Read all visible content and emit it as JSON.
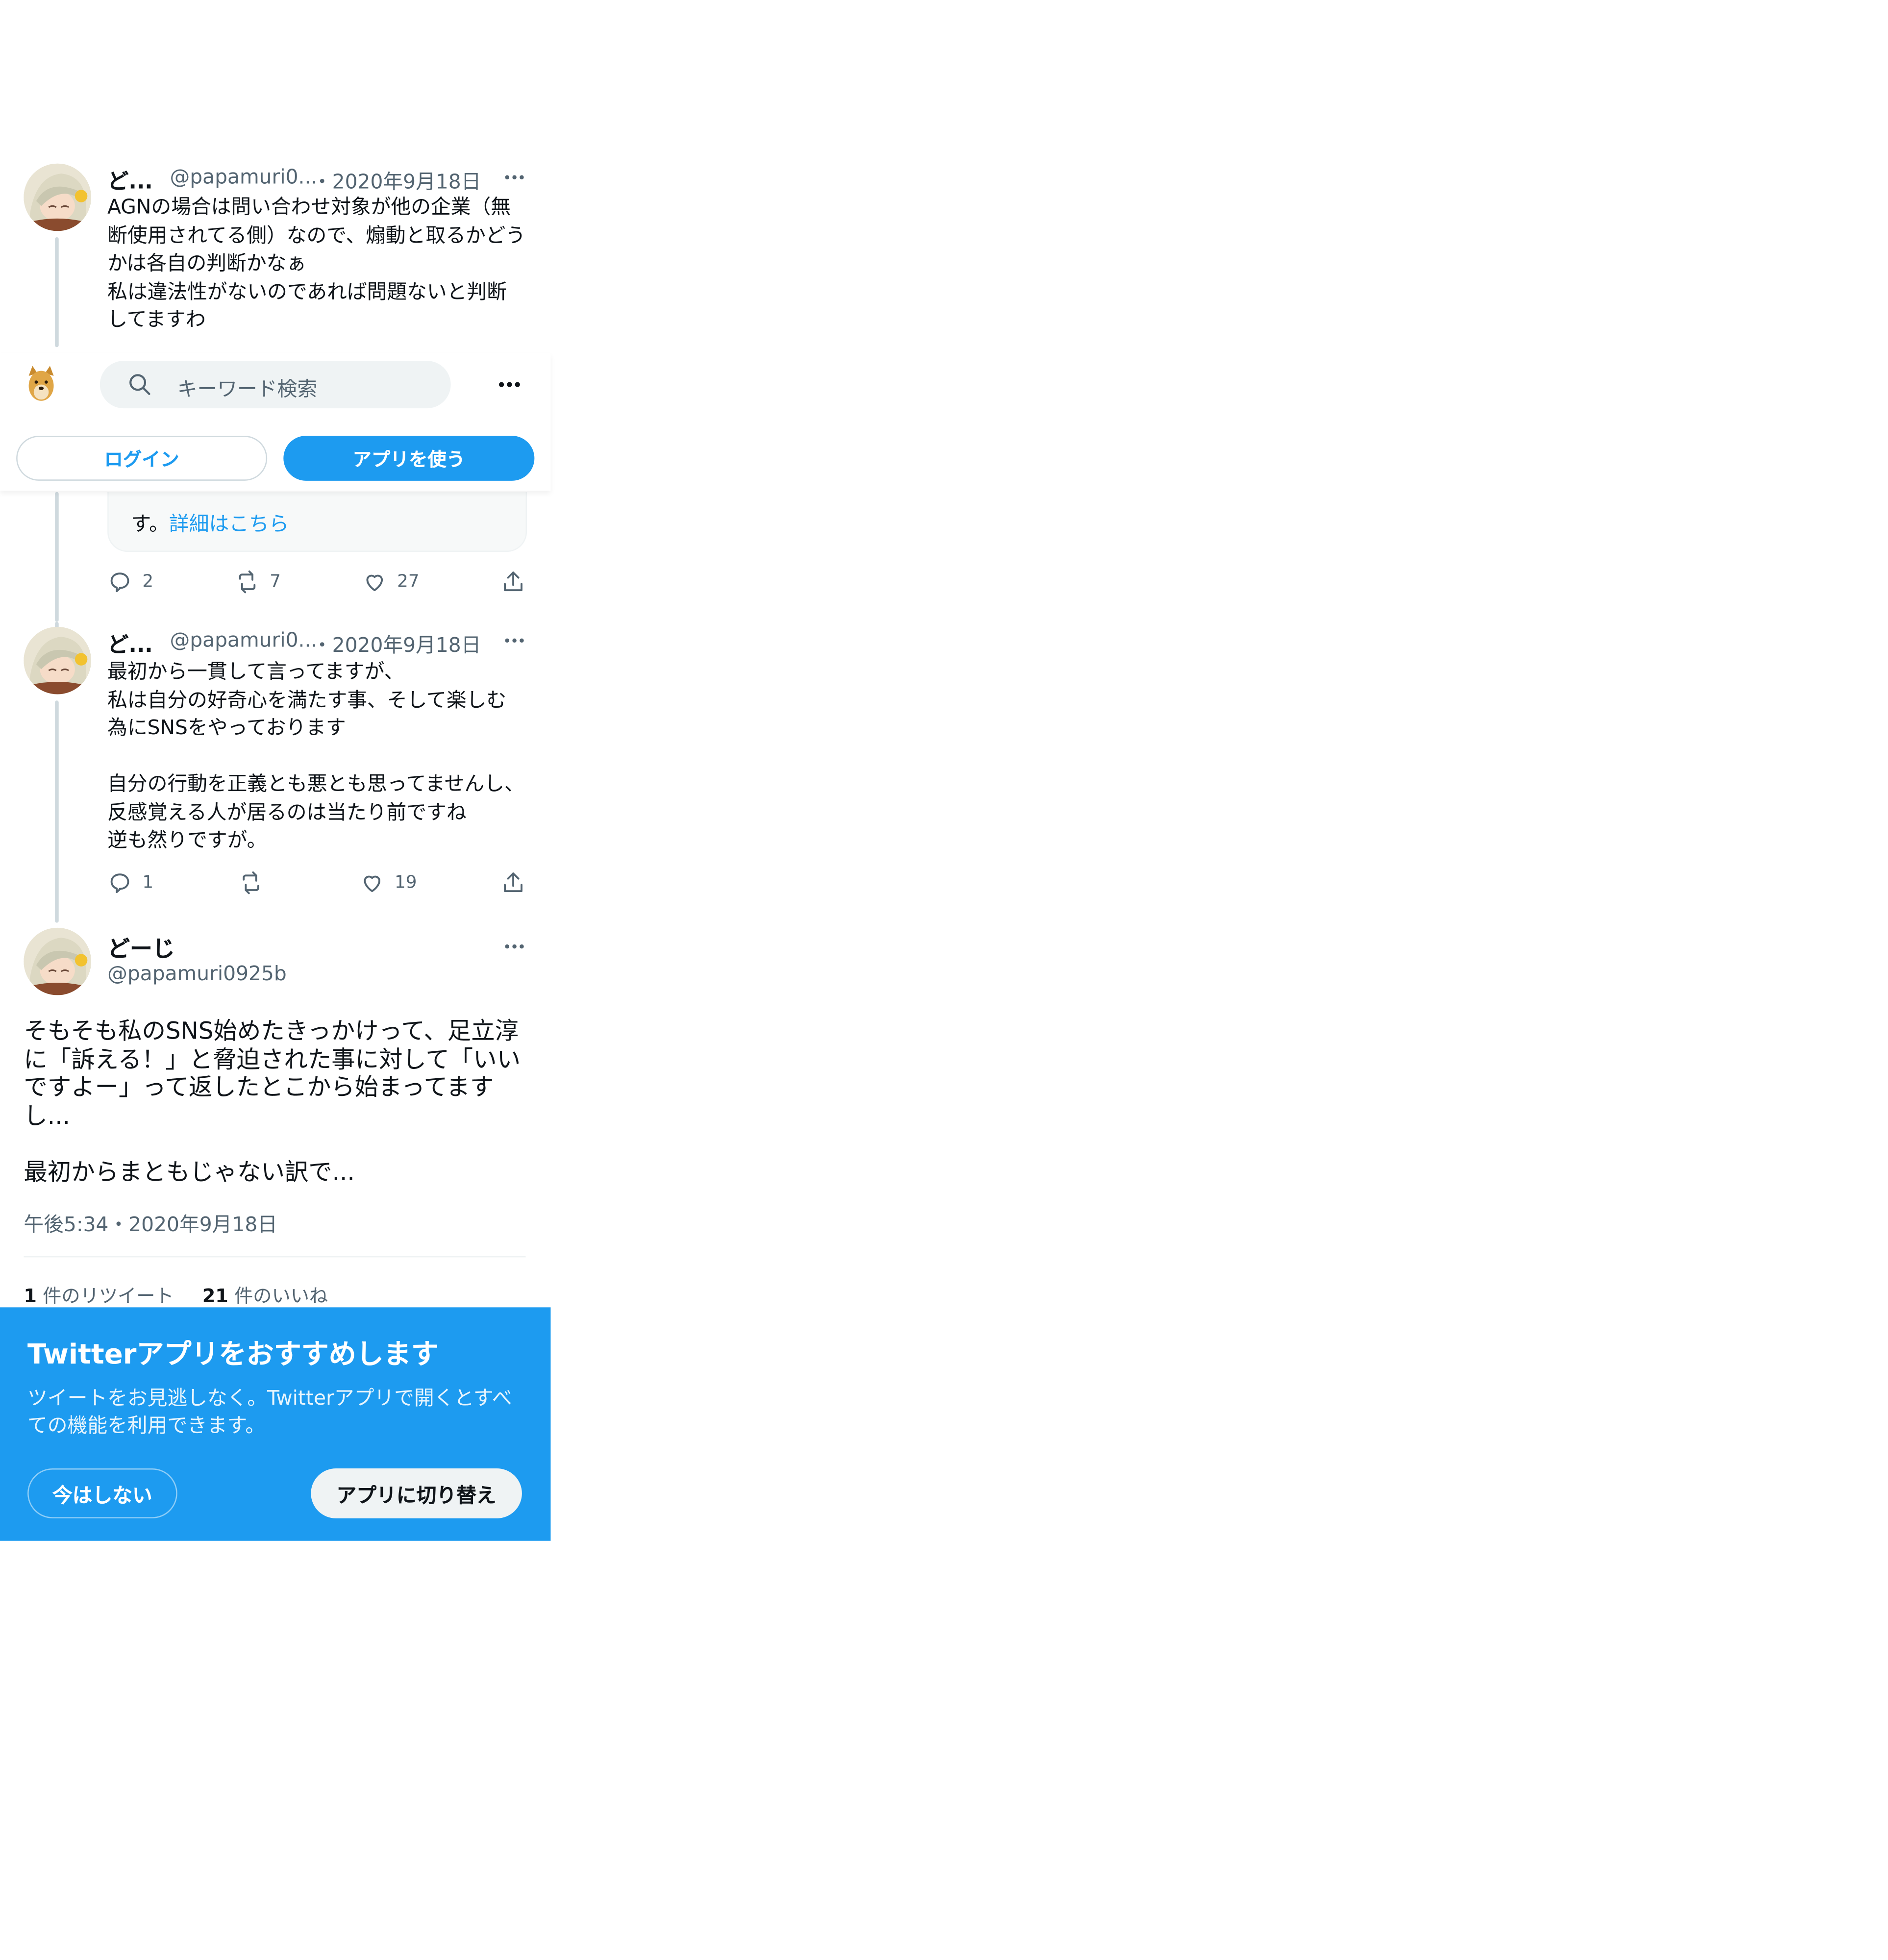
{
  "colors": {
    "accent": "#1d9bf0",
    "text_primary": "#0f1419",
    "text_secondary": "#536471",
    "thread_line": "#cfd9de"
  },
  "tweet1": {
    "display_name": "ど...",
    "handle": "@papamuri0...",
    "date": "・2020年9月18日",
    "text": "AGNの場合は問い合わせ対象が他の企業（無断使用されてる側）なので、煽動と取るかどうかは各自の判断かなぁ\n私は違法性がないのであれば問題ないと判断してますわ"
  },
  "header": {
    "logo_icon": "doge-avatar-icon",
    "search_placeholder": "キーワード検索",
    "login_label": "ログイン",
    "use_app_label": "アプリを使う"
  },
  "tweet_partial": {
    "card_text": "す。",
    "card_link": "詳細はこちら",
    "reply_count": "2",
    "retweet_count": "7",
    "like_count": "27"
  },
  "tweet2": {
    "display_name": "ど...",
    "handle": "@papamuri0...",
    "date": "・2020年9月18日",
    "text": "最初から一貫して言ってますが、\n私は自分の好奇心を満たす事、そして楽しむ為にSNSをやっております\n\n自分の行動を正義とも悪とも思ってませんし、反感覚える人が居るのは当たり前ですね\n逆も然りですが。",
    "reply_count": "1",
    "retweet_count": "",
    "like_count": "19"
  },
  "main_tweet": {
    "display_name": "どーじ",
    "handle": "@papamuri0925b",
    "text": "そもそも私のSNS始めたきっかけって、足立淳に「訴える！」と脅迫された事に対して「いいですよー」って返したとこから始まってますし...\n\n最初からまともじゃない訳で...",
    "timestamp": "午後5:34・2020年9月18日",
    "retweet_count": "1",
    "retweet_label": "件のリツイート",
    "like_count": "21",
    "like_label": "件のいいね"
  },
  "banner": {
    "title": "Twitterアプリをおすすめします",
    "description": "ツイートをお見逃しなく。Twitterアプリで開くとすべての機能を利用できます。",
    "dismiss_label": "今はしない",
    "switch_label": "アプリに切り替え"
  }
}
